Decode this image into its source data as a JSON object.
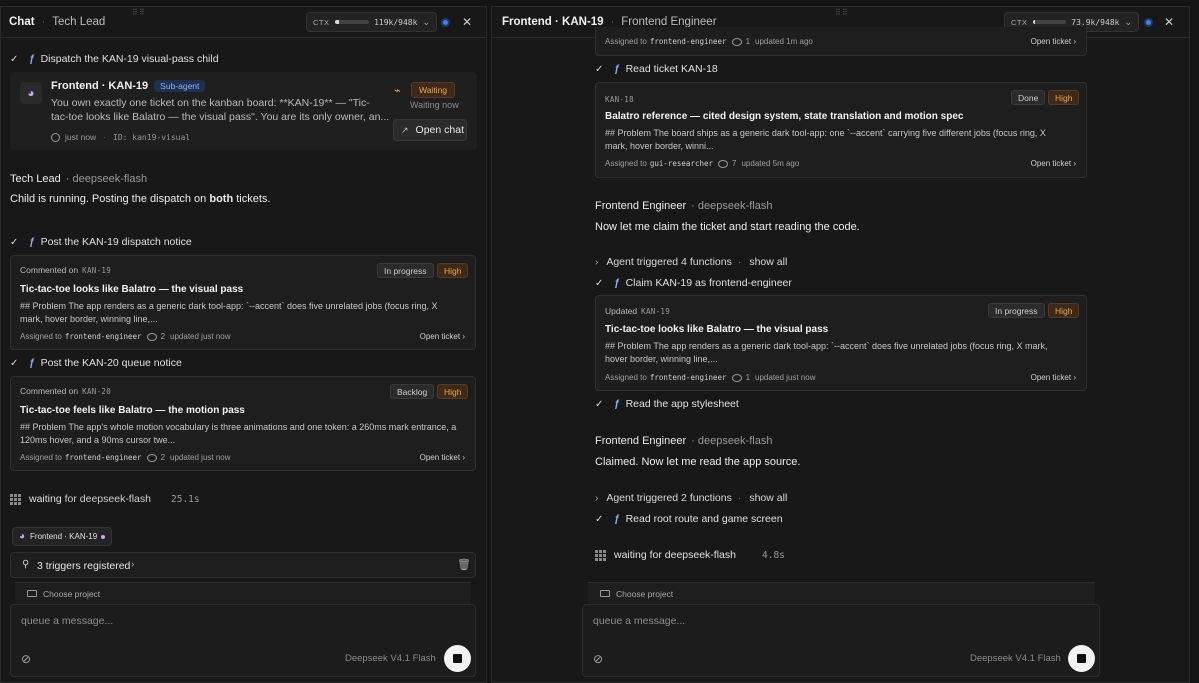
{
  "left": {
    "title": "Chat",
    "subtitle": "Tech Lead",
    "ctx": {
      "label": "CTX",
      "value": "119k/948k",
      "fill_fraction": 0.125
    },
    "steps": {
      "dispatch": "Dispatch the KAN-19 visual-pass child",
      "post_kan19": "Post the KAN-19 dispatch notice",
      "post_kan20": "Post the KAN-20 queue notice"
    },
    "subagent": {
      "name": "Frontend · KAN-19",
      "tag": "Sub-agent",
      "line1": "You own exactly one ticket on the kanban board: **KAN-19** — \"Tic-",
      "line2": "tac-toe looks like Balatro — the visual pass\". You are its only owner, an...",
      "time": "just now",
      "id": "ID: kan19-visual",
      "status": "Waiting",
      "status_sub": "Waiting now",
      "open_chat": "Open chat"
    },
    "speaker": {
      "who": "Tech Lead",
      "model": "· deepseek-flash"
    },
    "message": {
      "pre": "Child is running. Posting the dispatch on ",
      "bold": "both",
      "post": " tickets."
    },
    "card1": {
      "action": "Commented on",
      "ticket_id": "KAN-19",
      "status": "In progress",
      "priority": "High",
      "title": "Tic-tac-toe looks like Balatro — the visual pass",
      "body1": "## Problem The app renders as a generic dark tool-app: `--accent` does five unrelated jobs (focus ring, X",
      "body2": "mark, hover border, winning line,...",
      "assigned_prefix": "Assigned to",
      "assignee": "frontend-engineer",
      "comments": "2",
      "updated": "updated just now",
      "open": "Open ticket"
    },
    "card2": {
      "action": "Commented on",
      "ticket_id": "KAN-20",
      "status": "Backlog",
      "priority": "High",
      "title": "Tic-tac-toe feels like Balatro — the motion pass",
      "body1": "## Problem The app's whole motion vocabulary is three animations and one token: a 260ms mark entrance, a",
      "body2": "120ms hover, and a 90ms cursor twe...",
      "assigned_prefix": "Assigned to",
      "assignee": "frontend-engineer",
      "comments": "2",
      "updated": "updated just now",
      "open": "Open ticket"
    },
    "waiting": {
      "text_pre": "waiting",
      "text_post": " for deepseek-flash",
      "timer": "25.1s"
    },
    "chip": {
      "label": "Frontend · KAN-19"
    },
    "triggers": {
      "label": "3 triggers registered"
    },
    "composer": {
      "project": "Choose project",
      "placeholder": "queue a message...",
      "model": "Deepseek V4.1 Flash"
    }
  },
  "right": {
    "title": "Frontend · KAN-19",
    "subtitle": "Frontend Engineer",
    "ctx": {
      "label": "CTX",
      "value": "73.9k/948k",
      "fill_fraction": 0.078
    },
    "top_card": {
      "assigned_prefix": "Assigned to",
      "assignee": "frontend-engineer",
      "comments": "1",
      "updated": "updated 1m ago",
      "open": "Open ticket"
    },
    "step_read18": "Read ticket KAN-18",
    "card18": {
      "ticket_id": "KAN-18",
      "status": "Done",
      "priority": "High",
      "title": "Balatro reference — cited design system, state translation and motion spec",
      "body1": "## Problem The board ships as a generic dark tool-app: one `--accent` carrying five different jobs (focus ring, X",
      "body2": "mark, hover border, winni...",
      "assigned_prefix": "Assigned to",
      "assignee": "gui-researcher",
      "comments": "7",
      "updated": "updated 5m ago",
      "open": "Open ticket"
    },
    "speaker1": {
      "who": "Frontend Engineer",
      "model": "· deepseek-flash"
    },
    "message1": "Now let me claim the ticket and start reading the code.",
    "trigger1": {
      "label": "Agent triggered 4 functions",
      "show_all": "show all"
    },
    "step_claim": "Claim KAN-19 as frontend-engineer",
    "card19": {
      "action": "Updated",
      "ticket_id": "KAN-19",
      "status": "In progress",
      "priority": "High",
      "title": "Tic-tac-toe looks like Balatro — the visual pass",
      "body1": "## Problem The app renders as a generic dark tool-app: `--accent` does five unrelated jobs (focus ring, X mark,",
      "body2": "hover border, winning line,...",
      "assigned_prefix": "Assigned to",
      "assignee": "frontend-engineer",
      "comments": "1",
      "updated": "updated just now",
      "open": "Open ticket"
    },
    "step_stylesheet": "Read the app stylesheet",
    "speaker2": {
      "who": "Frontend Engineer",
      "model": "· deepseek-flash"
    },
    "message2": "Claimed. Now let me read the app source.",
    "trigger2": {
      "label": "Agent triggered 2 functions",
      "show_all": "show all"
    },
    "step_root": "Read root route and game screen",
    "waiting": {
      "text": "waiting for deepseek-flash",
      "timer": "4.8s"
    },
    "composer": {
      "project": "Choose project",
      "placeholder": "queue a message...",
      "model": "Deepseek V4.1 Flash"
    }
  }
}
